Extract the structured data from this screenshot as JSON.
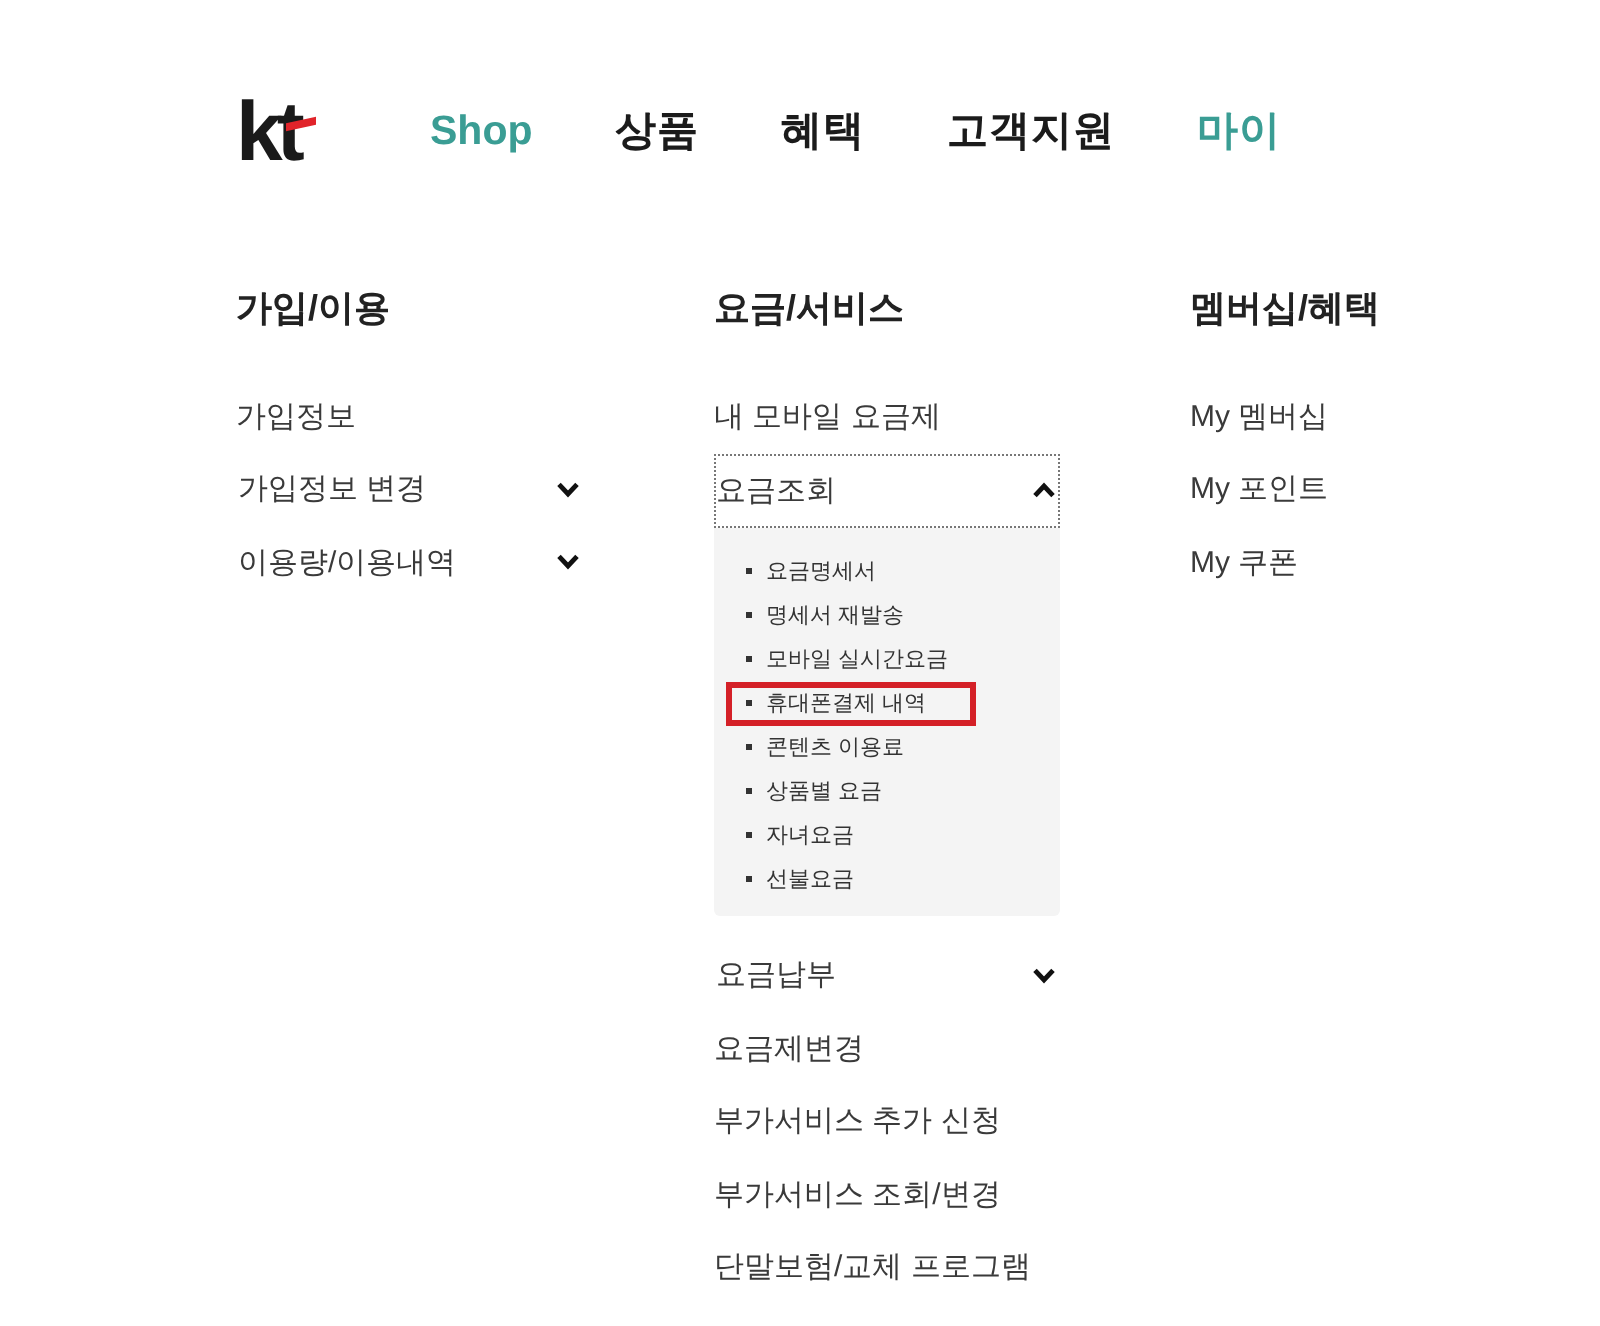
{
  "header": {
    "logo": "kt",
    "nav": [
      {
        "label": "Shop",
        "highlighted": true
      },
      {
        "label": "상품",
        "highlighted": false
      },
      {
        "label": "혜택",
        "highlighted": false
      },
      {
        "label": "고객지원",
        "highlighted": false
      },
      {
        "label": "마이",
        "highlighted": true
      }
    ]
  },
  "menu_columns": [
    {
      "heading": "가입/이용",
      "items": [
        {
          "label": "가입정보",
          "kind": "link"
        },
        {
          "label": "가입정보 변경",
          "kind": "toggle",
          "expanded": false
        },
        {
          "label": "이용량/이용내역",
          "kind": "toggle",
          "expanded": false
        }
      ]
    },
    {
      "heading": "요금/서비스",
      "items": [
        {
          "label": "내 모바일 요금제",
          "kind": "link"
        },
        {
          "label": "요금조회",
          "kind": "toggle",
          "expanded": true,
          "children": [
            {
              "label": "요금명세서",
              "highlighted": false
            },
            {
              "label": "명세서 재발송",
              "highlighted": false
            },
            {
              "label": "모바일 실시간요금",
              "highlighted": false
            },
            {
              "label": "휴대폰결제 내역",
              "highlighted": true
            },
            {
              "label": "콘텐츠 이용료",
              "highlighted": false
            },
            {
              "label": "상품별 요금",
              "highlighted": false
            },
            {
              "label": "자녀요금",
              "highlighted": false
            },
            {
              "label": "선불요금",
              "highlighted": false
            }
          ]
        },
        {
          "label": "요금납부",
          "kind": "toggle",
          "expanded": false
        },
        {
          "label": "요금제변경",
          "kind": "link"
        },
        {
          "label": "부가서비스 추가 신청",
          "kind": "link"
        },
        {
          "label": "부가서비스 조회/변경",
          "kind": "link"
        },
        {
          "label": "단말보험/교체 프로그램",
          "kind": "link"
        }
      ]
    },
    {
      "heading": "멤버십/혜택",
      "items": [
        {
          "label": "My 멤버십",
          "kind": "link"
        },
        {
          "label": "My 포인트",
          "kind": "link"
        },
        {
          "label": "My 쿠폰",
          "kind": "link"
        }
      ]
    }
  ]
}
